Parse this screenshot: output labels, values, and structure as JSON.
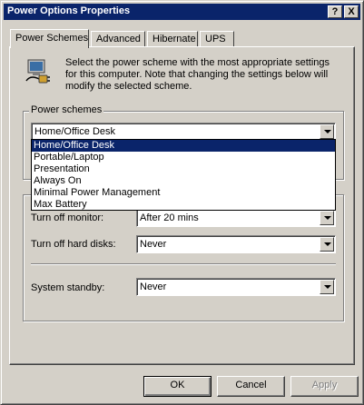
{
  "window": {
    "title": "Power Options Properties",
    "help_glyph": "?",
    "close_glyph": "X"
  },
  "tabs": [
    {
      "label": "Power Schemes",
      "active": true
    },
    {
      "label": "Advanced"
    },
    {
      "label": "Hibernate"
    },
    {
      "label": "UPS"
    }
  ],
  "description": "Select the power scheme with the most appropriate settings for this computer. Note that changing the settings below will modify the selected scheme.",
  "schemes": {
    "group_label": "Power schemes",
    "selected": "Home/Office Desk",
    "options": [
      "Home/Office Desk",
      "Portable/Laptop",
      "Presentation",
      "Always On",
      "Minimal Power Management",
      "Max Battery"
    ]
  },
  "settings": {
    "monitor_label": "Turn off monitor:",
    "monitor_value": "After 20 mins",
    "hdd_label": "Turn off hard disks:",
    "hdd_value": "Never",
    "standby_label": "System standby:",
    "standby_value": "Never"
  },
  "buttons": {
    "ok": "OK",
    "cancel": "Cancel",
    "apply": "Apply"
  },
  "icons": {
    "scheme_icon": "power-plug-monitor-icon"
  }
}
